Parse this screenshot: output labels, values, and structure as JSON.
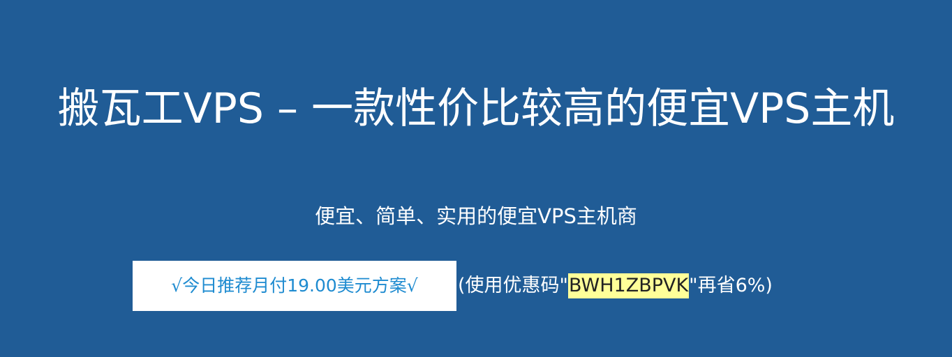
{
  "hero": {
    "title": "搬瓦工VPS – 一款性价比较高的便宜VPS主机",
    "subtitle": "便宜、简单、实用的便宜VPS主机商",
    "promo_button_label": "√今日推荐月付19.00美元方案√",
    "coupon_prefix": "(使用优惠码\" ",
    "coupon_code": "BWH1ZBPVK",
    "coupon_suffix": " \"再省6%)"
  },
  "colors": {
    "background": "#205c96",
    "button_text": "#1e8bd0",
    "coupon_highlight": "#ffff99"
  }
}
